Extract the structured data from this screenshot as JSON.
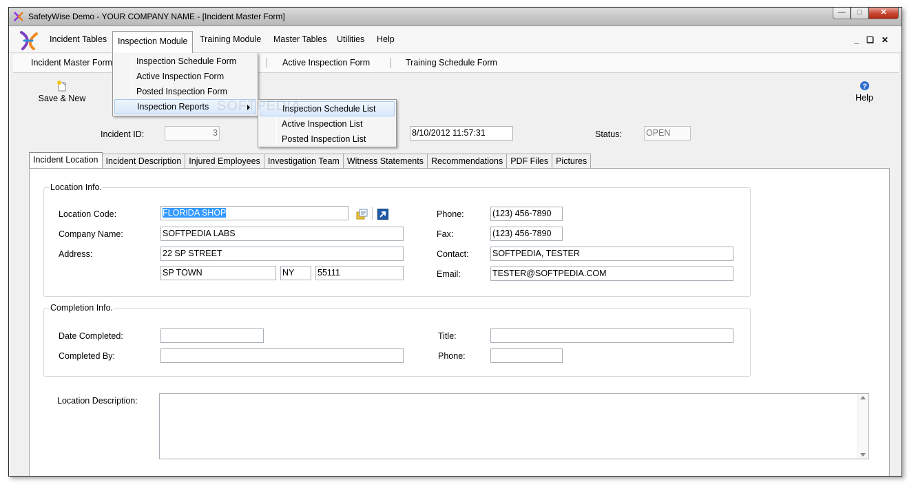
{
  "window": {
    "title": "SafetyWise Demo - YOUR COMPANY NAME - [Incident Master Form]"
  },
  "menu": {
    "items": [
      "Incident Tables",
      "Inspection Module",
      "Training Module",
      "Master Tables",
      "Utilities",
      "Help"
    ],
    "open_item": "Inspection Module"
  },
  "inspection_menu": {
    "items": [
      "Inspection Schedule Form",
      "Active Inspection Form",
      "Posted Inspection Form",
      "Inspection Reports"
    ]
  },
  "reports_submenu": {
    "items": [
      "Inspection Schedule List",
      "Active Inspection List",
      "Posted Inspection List"
    ]
  },
  "doc_tabs": [
    "Incident Master Form",
    "Active Inspection Form",
    "Training Schedule Form"
  ],
  "toolbar": {
    "save_new": "Save & New",
    "help": "Help"
  },
  "header": {
    "incident_id_label": "Incident ID:",
    "incident_id": "3",
    "datetime": "8/10/2012 11:57:31",
    "status_label": "Status:",
    "status": "OPEN"
  },
  "tabs": [
    "Incident Location",
    "Incident Description",
    "Injured Employees",
    "Investigation Team",
    "Witness Statements",
    "Recommendations",
    "PDF Files",
    "Pictures"
  ],
  "location": {
    "group_title": "Location Info.",
    "code_label": "Location Code:",
    "code": "FLORIDA SHOP",
    "company_label": "Company Name:",
    "company": "SOFTPEDIA LABS",
    "address_label": "Address:",
    "address": "22 SP STREET",
    "city": "SP TOWN",
    "state": "NY",
    "zip": "55111",
    "phone_label": "Phone:",
    "phone": "(123) 456-7890",
    "fax_label": "Fax:",
    "fax": "(123) 456-7890",
    "contact_label": "Contact:",
    "contact": "SOFTPEDIA, TESTER",
    "email_label": "Email:",
    "email": "TESTER@SOFTPEDIA.COM"
  },
  "completion": {
    "group_title": "Completion Info.",
    "date_label": "Date Completed:",
    "by_label": "Completed By:",
    "title_label": "Title:",
    "phone_label": "Phone:"
  },
  "description_label": "Location Description:",
  "watermark": "SOFTPEDIA"
}
